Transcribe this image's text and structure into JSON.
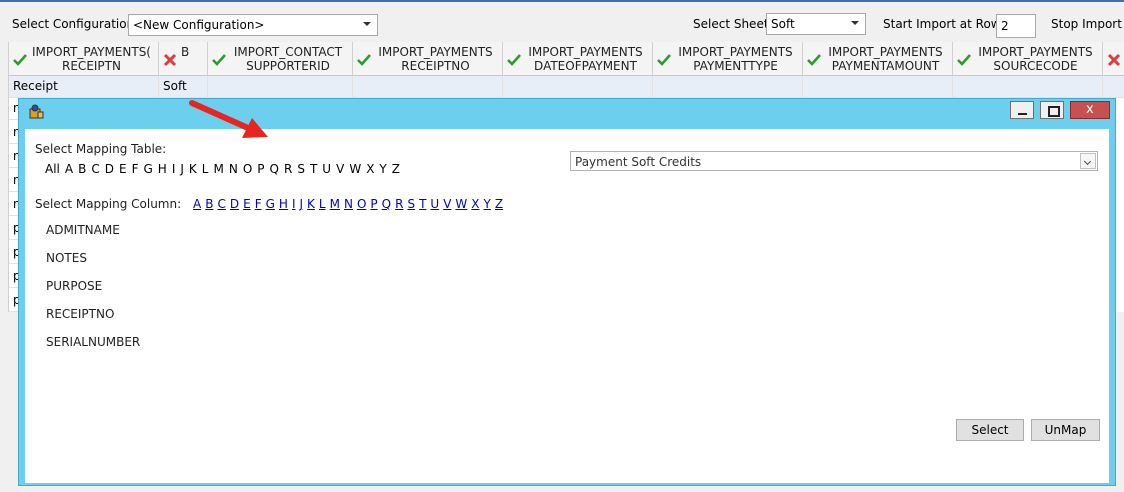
{
  "toolbar": {
    "select_configuration_label": "Select Configuration",
    "configuration_value": "<New Configuration>",
    "select_sheet_label": "Select Sheet",
    "sheet_value": "Soft",
    "start_import_label": "Start Import at Row:",
    "start_import_value": "2",
    "stop_import_label": "Stop Import a"
  },
  "grid": {
    "headers": [
      {
        "status": "ok",
        "text": "IMPORT_PAYMENTS(\nRECEIPTN"
      },
      {
        "status": "error",
        "text": "B"
      },
      {
        "status": "ok",
        "text": "IMPORT_CONTACT\nSUPPORTERID"
      },
      {
        "status": "ok",
        "text": "IMPORT_PAYMENTS\nRECEIPTNO"
      },
      {
        "status": "ok",
        "text": "IMPORT_PAYMENTS\nDATEOFPAYMENT"
      },
      {
        "status": "ok",
        "text": "IMPORT_PAYMENTS\nPAYMENTTYPE"
      },
      {
        "status": "ok",
        "text": "IMPORT_PAYMENTS\nPAYMENTAMOUNT"
      },
      {
        "status": "ok",
        "text": "IMPORT_PAYMENTS\nSOURCECODE"
      },
      {
        "status": "error",
        "text": ""
      }
    ],
    "rows": [
      {
        "c0": "Receipt",
        "c1": "Soft"
      },
      {
        "c0": "n",
        "c1": ""
      },
      {
        "c0": "n",
        "c1": ""
      },
      {
        "c0": "n",
        "c1": ""
      },
      {
        "c0": "n",
        "c1": ""
      },
      {
        "c0": "n",
        "c1": ""
      },
      {
        "c0": "p",
        "c1": ""
      },
      {
        "c0": "p",
        "c1": ""
      },
      {
        "c0": "p",
        "c1": ""
      },
      {
        "c0": "p",
        "c1": ""
      }
    ]
  },
  "dialog": {
    "close_glyph": "x",
    "select_mapping_table_label": "Select Mapping Table:",
    "table_letters": [
      "All",
      "A",
      "B",
      "C",
      "D",
      "E",
      "F",
      "G",
      "H",
      "I",
      "J",
      "K",
      "L",
      "M",
      "N",
      "O",
      "P",
      "Q",
      "R",
      "S",
      "T",
      "U",
      "V",
      "W",
      "X",
      "Y",
      "Z"
    ],
    "mapping_table_value": "Payment Soft Credits",
    "select_mapping_column_label": "Select Mapping Column:",
    "column_letters": [
      "A",
      "B",
      "C",
      "D",
      "E",
      "F",
      "G",
      "H",
      "I",
      "J",
      "K",
      "L",
      "M",
      "N",
      "O",
      "P",
      "Q",
      "R",
      "S",
      "T",
      "U",
      "V",
      "W",
      "X",
      "Y",
      "Z"
    ],
    "columns": [
      "ADMITNAME",
      "NOTES",
      "PURPOSE",
      "RECEIPTNO",
      "SERIALNUMBER"
    ],
    "select_button": "Select",
    "unmap_button": "UnMap"
  },
  "colors": {
    "dialog_frame": "#6ccfee",
    "ok_check": "#2a9d2a",
    "error_x": "#e03a3a",
    "link": "#0000cc",
    "arrow": "#e8251f"
  }
}
